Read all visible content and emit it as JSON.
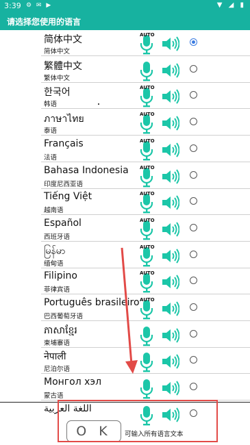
{
  "status_bar": {
    "time": "3:39"
  },
  "header": {
    "title": "请选择您使用的语言"
  },
  "auto_label": "AUTO",
  "languages": [
    {
      "native": "简体中文",
      "cn": "简体中文",
      "auto": true,
      "selected": true
    },
    {
      "native": "繁體中文",
      "cn": "繁体中文",
      "auto": false,
      "selected": false
    },
    {
      "native": "한국어",
      "cn": "韩语",
      "auto": true,
      "selected": false
    },
    {
      "native": "ภาษาไทย",
      "cn": "泰语",
      "auto": true,
      "selected": false
    },
    {
      "native": "Français",
      "cn": "法语",
      "auto": true,
      "selected": false
    },
    {
      "native": "Bahasa Indonesia",
      "cn": "印度尼西亚语",
      "auto": true,
      "selected": false
    },
    {
      "native": "Tiếng Việt",
      "cn": "越南语",
      "auto": true,
      "selected": false
    },
    {
      "native": "Español",
      "cn": "西班牙语",
      "auto": true,
      "selected": false
    },
    {
      "native": "မြန်မာ",
      "cn": "缅甸语",
      "auto": true,
      "selected": false
    },
    {
      "native": "Filipino",
      "cn": "菲律宾语",
      "auto": true,
      "selected": false
    },
    {
      "native": "Português brasileiro",
      "cn": "巴西葡萄牙语",
      "auto": true,
      "selected": false
    },
    {
      "native": "ភាសាខ្មែរ",
      "cn": "柬埔寨语",
      "auto": false,
      "selected": false
    },
    {
      "native": "नेपाली",
      "cn": "尼泊尔语",
      "auto": false,
      "selected": false
    },
    {
      "native": "Монгол хэл",
      "cn": "蒙古语",
      "auto": false,
      "selected": false
    },
    {
      "native": "اللغة العربية",
      "cn": "",
      "auto": false,
      "selected": false
    }
  ],
  "footer": {
    "ok_label": "O K",
    "hint": "可输入所有语言文本"
  },
  "colors": {
    "accent": "#17b2a0",
    "icon": "#1cc6a8",
    "annotation": "#e24a47",
    "radio_selected": "#3a7be0"
  },
  "icons": {
    "mic": "mic-icon",
    "speaker": "speaker-icon"
  }
}
